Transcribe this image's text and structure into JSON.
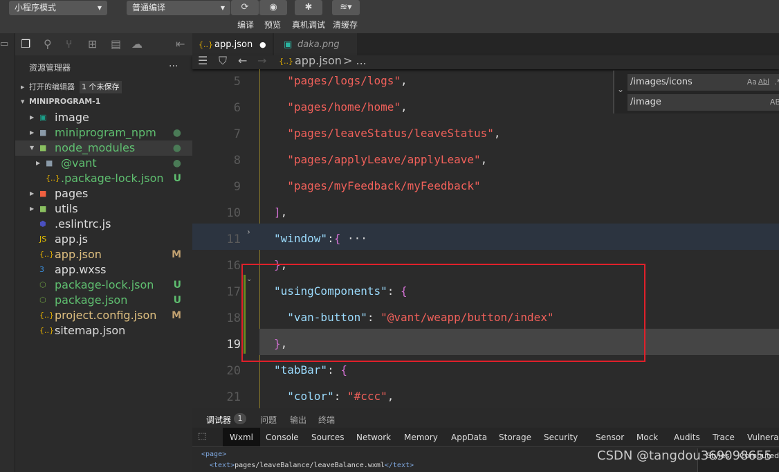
{
  "toolbar": {
    "mode": "小程序模式",
    "compile_mode": "普通编译",
    "compile": "编译",
    "preview": "预览",
    "remote_debug": "真机调试",
    "clear_cache": "清缓存"
  },
  "sidebar": {
    "title": "资源管理器",
    "more": "...",
    "open_editors": "打开的编辑器",
    "unsaved_badge": "1 个未保存",
    "project": "MINIPROGRAM-1",
    "items": [
      {
        "name": "image",
        "status": ""
      },
      {
        "name": "miniprogram_npm",
        "status": "●"
      },
      {
        "name": "node_modules",
        "status": "●"
      },
      {
        "name": "@vant",
        "status": "●"
      },
      {
        "name": ".package-lock.json",
        "status": "U"
      },
      {
        "name": "pages",
        "status": ""
      },
      {
        "name": "utils",
        "status": ""
      },
      {
        "name": ".eslintrc.js",
        "status": ""
      },
      {
        "name": "app.js",
        "status": ""
      },
      {
        "name": "app.json",
        "status": "M"
      },
      {
        "name": "app.wxss",
        "status": ""
      },
      {
        "name": "package-lock.json",
        "status": "U"
      },
      {
        "name": "package.json",
        "status": "U"
      },
      {
        "name": "project.config.json",
        "status": "M"
      },
      {
        "name": "sitemap.json",
        "status": ""
      }
    ]
  },
  "editor": {
    "tabs": [
      {
        "label": "app.json",
        "dirty": "●"
      },
      {
        "label": "daka.png"
      }
    ],
    "breadcrumb": "app.json",
    "breadcrumb_more": "> ...",
    "lines": [
      {
        "n": "5",
        "parts": [
          [
            "s",
            "  \"pages/logs/logs\""
          ],
          [
            "b",
            ","
          ]
        ]
      },
      {
        "n": "6",
        "parts": [
          [
            "s",
            "  \"pages/home/home\""
          ],
          [
            "b",
            ","
          ]
        ]
      },
      {
        "n": "7",
        "parts": [
          [
            "s",
            "  \"pages/leaveStatus/leaveStatus\""
          ],
          [
            "b",
            ","
          ]
        ]
      },
      {
        "n": "8",
        "parts": [
          [
            "s",
            "  \"pages/applyLeave/applyLeave\""
          ],
          [
            "b",
            ","
          ]
        ]
      },
      {
        "n": "9",
        "parts": [
          [
            "s",
            "  \"pages/myFeedback/myFeedback\""
          ]
        ]
      },
      {
        "n": "10",
        "parts": [
          [
            "p",
            "]"
          ],
          [
            "b",
            ","
          ]
        ]
      },
      {
        "n": "11",
        "parts": [
          [
            "k",
            "\"window\""
          ],
          [
            "b",
            ":"
          ],
          [
            "p",
            "{"
          ],
          [
            "b",
            " ···"
          ]
        ]
      },
      {
        "n": "16",
        "parts": [
          [
            "p",
            "}"
          ],
          [
            "b",
            ","
          ]
        ]
      },
      {
        "n": "17",
        "parts": [
          [
            "k",
            "\"usingComponents\""
          ],
          [
            "b",
            ": "
          ],
          [
            "p",
            "{"
          ]
        ]
      },
      {
        "n": "18",
        "parts": [
          [
            "k",
            "  \"van-button\""
          ],
          [
            "b",
            ": "
          ],
          [
            "s",
            "\"@vant/weapp/button/index\""
          ]
        ]
      },
      {
        "n": "19",
        "parts": [
          [
            "p",
            "}"
          ],
          [
            "b",
            ","
          ]
        ]
      },
      {
        "n": "20",
        "parts": [
          [
            "k",
            "\"tabBar\""
          ],
          [
            "b",
            ": "
          ],
          [
            "p",
            "{"
          ]
        ]
      },
      {
        "n": "21",
        "parts": [
          [
            "k",
            "  \"color\""
          ],
          [
            "b",
            ": "
          ],
          [
            "s",
            "\"#ccc\""
          ],
          [
            "b",
            ","
          ]
        ]
      }
    ],
    "find": {
      "search": "/images/icons",
      "replace": "/image",
      "opt_case": "Aa",
      "opt_word": "Abl",
      "opt_regex": ".*",
      "opt_preserve": "AB"
    }
  },
  "panel": {
    "tabs": [
      "调试器",
      "问题",
      "输出",
      "终端"
    ],
    "debug_count": "1",
    "devtools": [
      "Wxml",
      "Console",
      "Sources",
      "Network",
      "Memory",
      "AppData",
      "Storage",
      "Security",
      "Sensor",
      "Mock",
      "Audits",
      "Trace",
      "Vulnerab"
    ],
    "wxml_line1": "<page>",
    "wxml_line2_open": "<text>",
    "wxml_line2_text": "pages/leaveBalance/leaveBalance.wxml",
    "wxml_line2_close": "</text>",
    "styles": "Styles",
    "computed": "Computed"
  },
  "watermark": "CSDN @tangdou369098655",
  "colors": {
    "highlight_box": "#e0202a",
    "string": "#f0605a",
    "key": "#9cdcfe"
  }
}
